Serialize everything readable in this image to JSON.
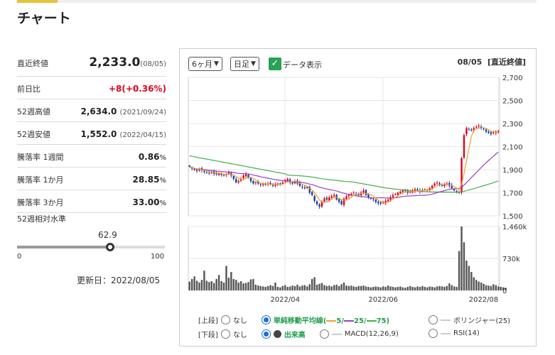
{
  "page": {
    "title": "チャート"
  },
  "stats": {
    "latest_close": {
      "label": "直近終値",
      "value": "2,233.0",
      "date": "(08/05)"
    },
    "change": {
      "label": "前日比",
      "value": "+8(+0.36%)"
    },
    "high52": {
      "label": "52週高値",
      "value": "2,634.0",
      "date": "(2021/09/24)"
    },
    "low52": {
      "label": "52週安値",
      "value": "1,552.0",
      "date": "(2022/04/15)"
    },
    "week1": {
      "label": "騰落率 1週間",
      "value": "0.86",
      "unit": "%"
    },
    "month1": {
      "label": "騰落率 1か月",
      "value": "28.85",
      "unit": "%"
    },
    "month3": {
      "label": "騰落率 3か月",
      "value": "33.00",
      "unit": "%"
    }
  },
  "level": {
    "label": "52週相対水準",
    "value": "62.9",
    "fraction": 0.629,
    "min": "0",
    "max": "100"
  },
  "updated": "更新日：2022/08/05",
  "controls": {
    "period": "6ヶ月",
    "interval": "日足",
    "data_display": "データ表示",
    "header_date": "08/05",
    "header_label": "[直近終値]"
  },
  "options": {
    "upper_label": "[上段]",
    "lower_label": "[下段]",
    "none": "なし",
    "sma_prefix": "単純移動平均線(",
    "sma5": "5/",
    "sma25": "25/",
    "sma75": "75)",
    "bollinger": "ボリンジャー(25)",
    "volume": "出来高",
    "macd": "MACD(12,26,9)",
    "rsi": "RSI(14)"
  },
  "chart_data": {
    "type": "candlestick+volume",
    "price_axis": {
      "ticks": [
        "2,700",
        "2,500",
        "2,300",
        "2,100",
        "1,900",
        "1,700",
        "1,500"
      ],
      "ylim": [
        1500,
        2700
      ]
    },
    "volume_axis": {
      "ticks": [
        "1,460k",
        "730k",
        "0"
      ],
      "ylim": [
        0,
        1460
      ]
    },
    "x_ticks": [
      "2022/04",
      "2022/06",
      "2022/08"
    ],
    "colors": {
      "up": "#e0001b",
      "down": "#1f3fa0",
      "sma5": "#f0a030",
      "sma25": "#9b3fc0",
      "sma75": "#44b04a",
      "volume": "#555555"
    },
    "close": [
      1925,
      1910,
      1900,
      1890,
      1905,
      1895,
      1880,
      1875,
      1870,
      1880,
      1865,
      1860,
      1870,
      1855,
      1850,
      1860,
      1880,
      1850,
      1820,
      1790,
      1800,
      1820,
      1850,
      1860,
      1830,
      1800,
      1780,
      1790,
      1780,
      1770,
      1775,
      1770,
      1780,
      1775,
      1765,
      1770,
      1780,
      1775,
      1790,
      1810,
      1820,
      1790,
      1780,
      1800,
      1780,
      1760,
      1750,
      1740,
      1750,
      1700,
      1680,
      1630,
      1600,
      1580,
      1620,
      1650,
      1640,
      1660,
      1670,
      1680,
      1640,
      1620,
      1600,
      1650,
      1670,
      1680,
      1690,
      1700,
      1690,
      1680,
      1700,
      1720,
      1680,
      1660,
      1650,
      1640,
      1620,
      1610,
      1605,
      1615,
      1630,
      1640,
      1660,
      1680,
      1690,
      1700,
      1710,
      1720,
      1715,
      1700,
      1710,
      1720,
      1730,
      1720,
      1710,
      1720,
      1730,
      1725,
      1740,
      1760,
      1780,
      1790,
      1770,
      1760,
      1770,
      1780,
      1760,
      1740,
      1720,
      1710,
      1700,
      2000,
      2200,
      2260,
      2250,
      2240,
      2260,
      2270,
      2280,
      2260,
      2250,
      2230,
      2220,
      2210,
      2225,
      2230,
      2233
    ],
    "volume": [
      200,
      260,
      320,
      220,
      180,
      240,
      450,
      220,
      190,
      210,
      170,
      260,
      350,
      210,
      180,
      560,
      290,
      420,
      260,
      240,
      180,
      210,
      160,
      170,
      190,
      250,
      260,
      130,
      110,
      100,
      90,
      80,
      100,
      120,
      100,
      180,
      80,
      70,
      100,
      120,
      80,
      90,
      110,
      100,
      130,
      90,
      110,
      120,
      90,
      140,
      260,
      300,
      130,
      150,
      170,
      120,
      100,
      110,
      90,
      120,
      130,
      100,
      140,
      180,
      110,
      100,
      110,
      90,
      80,
      100,
      100,
      110,
      90,
      80,
      70,
      80,
      90,
      80,
      70,
      90,
      80,
      110,
      90,
      80,
      70,
      80,
      90,
      70,
      60,
      80,
      100,
      80,
      70,
      90,
      80,
      100,
      80,
      70,
      90,
      80,
      70,
      90,
      100,
      90,
      80,
      100,
      160,
      120,
      90,
      80,
      900,
      1460,
      1100,
      680,
      560,
      420,
      300,
      240,
      200,
      180,
      150,
      120,
      110,
      100,
      140,
      120,
      90,
      80,
      70,
      60
    ]
  }
}
